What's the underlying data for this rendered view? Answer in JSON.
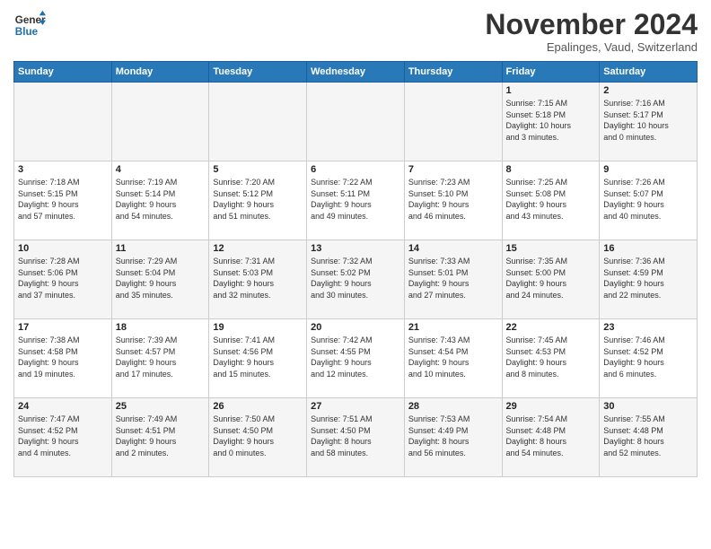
{
  "logo": {
    "line1": "General",
    "line2": "Blue"
  },
  "title": "November 2024",
  "subtitle": "Epalinges, Vaud, Switzerland",
  "days_header": [
    "Sunday",
    "Monday",
    "Tuesday",
    "Wednesday",
    "Thursday",
    "Friday",
    "Saturday"
  ],
  "weeks": [
    [
      {
        "day": "",
        "info": ""
      },
      {
        "day": "",
        "info": ""
      },
      {
        "day": "",
        "info": ""
      },
      {
        "day": "",
        "info": ""
      },
      {
        "day": "",
        "info": ""
      },
      {
        "day": "1",
        "info": "Sunrise: 7:15 AM\nSunset: 5:18 PM\nDaylight: 10 hours\nand 3 minutes."
      },
      {
        "day": "2",
        "info": "Sunrise: 7:16 AM\nSunset: 5:17 PM\nDaylight: 10 hours\nand 0 minutes."
      }
    ],
    [
      {
        "day": "3",
        "info": "Sunrise: 7:18 AM\nSunset: 5:15 PM\nDaylight: 9 hours\nand 57 minutes."
      },
      {
        "day": "4",
        "info": "Sunrise: 7:19 AM\nSunset: 5:14 PM\nDaylight: 9 hours\nand 54 minutes."
      },
      {
        "day": "5",
        "info": "Sunrise: 7:20 AM\nSunset: 5:12 PM\nDaylight: 9 hours\nand 51 minutes."
      },
      {
        "day": "6",
        "info": "Sunrise: 7:22 AM\nSunset: 5:11 PM\nDaylight: 9 hours\nand 49 minutes."
      },
      {
        "day": "7",
        "info": "Sunrise: 7:23 AM\nSunset: 5:10 PM\nDaylight: 9 hours\nand 46 minutes."
      },
      {
        "day": "8",
        "info": "Sunrise: 7:25 AM\nSunset: 5:08 PM\nDaylight: 9 hours\nand 43 minutes."
      },
      {
        "day": "9",
        "info": "Sunrise: 7:26 AM\nSunset: 5:07 PM\nDaylight: 9 hours\nand 40 minutes."
      }
    ],
    [
      {
        "day": "10",
        "info": "Sunrise: 7:28 AM\nSunset: 5:06 PM\nDaylight: 9 hours\nand 37 minutes."
      },
      {
        "day": "11",
        "info": "Sunrise: 7:29 AM\nSunset: 5:04 PM\nDaylight: 9 hours\nand 35 minutes."
      },
      {
        "day": "12",
        "info": "Sunrise: 7:31 AM\nSunset: 5:03 PM\nDaylight: 9 hours\nand 32 minutes."
      },
      {
        "day": "13",
        "info": "Sunrise: 7:32 AM\nSunset: 5:02 PM\nDaylight: 9 hours\nand 30 minutes."
      },
      {
        "day": "14",
        "info": "Sunrise: 7:33 AM\nSunset: 5:01 PM\nDaylight: 9 hours\nand 27 minutes."
      },
      {
        "day": "15",
        "info": "Sunrise: 7:35 AM\nSunset: 5:00 PM\nDaylight: 9 hours\nand 24 minutes."
      },
      {
        "day": "16",
        "info": "Sunrise: 7:36 AM\nSunset: 4:59 PM\nDaylight: 9 hours\nand 22 minutes."
      }
    ],
    [
      {
        "day": "17",
        "info": "Sunrise: 7:38 AM\nSunset: 4:58 PM\nDaylight: 9 hours\nand 19 minutes."
      },
      {
        "day": "18",
        "info": "Sunrise: 7:39 AM\nSunset: 4:57 PM\nDaylight: 9 hours\nand 17 minutes."
      },
      {
        "day": "19",
        "info": "Sunrise: 7:41 AM\nSunset: 4:56 PM\nDaylight: 9 hours\nand 15 minutes."
      },
      {
        "day": "20",
        "info": "Sunrise: 7:42 AM\nSunset: 4:55 PM\nDaylight: 9 hours\nand 12 minutes."
      },
      {
        "day": "21",
        "info": "Sunrise: 7:43 AM\nSunset: 4:54 PM\nDaylight: 9 hours\nand 10 minutes."
      },
      {
        "day": "22",
        "info": "Sunrise: 7:45 AM\nSunset: 4:53 PM\nDaylight: 9 hours\nand 8 minutes."
      },
      {
        "day": "23",
        "info": "Sunrise: 7:46 AM\nSunset: 4:52 PM\nDaylight: 9 hours\nand 6 minutes."
      }
    ],
    [
      {
        "day": "24",
        "info": "Sunrise: 7:47 AM\nSunset: 4:52 PM\nDaylight: 9 hours\nand 4 minutes."
      },
      {
        "day": "25",
        "info": "Sunrise: 7:49 AM\nSunset: 4:51 PM\nDaylight: 9 hours\nand 2 minutes."
      },
      {
        "day": "26",
        "info": "Sunrise: 7:50 AM\nSunset: 4:50 PM\nDaylight: 9 hours\nand 0 minutes."
      },
      {
        "day": "27",
        "info": "Sunrise: 7:51 AM\nSunset: 4:50 PM\nDaylight: 8 hours\nand 58 minutes."
      },
      {
        "day": "28",
        "info": "Sunrise: 7:53 AM\nSunset: 4:49 PM\nDaylight: 8 hours\nand 56 minutes."
      },
      {
        "day": "29",
        "info": "Sunrise: 7:54 AM\nSunset: 4:48 PM\nDaylight: 8 hours\nand 54 minutes."
      },
      {
        "day": "30",
        "info": "Sunrise: 7:55 AM\nSunset: 4:48 PM\nDaylight: 8 hours\nand 52 minutes."
      }
    ]
  ]
}
